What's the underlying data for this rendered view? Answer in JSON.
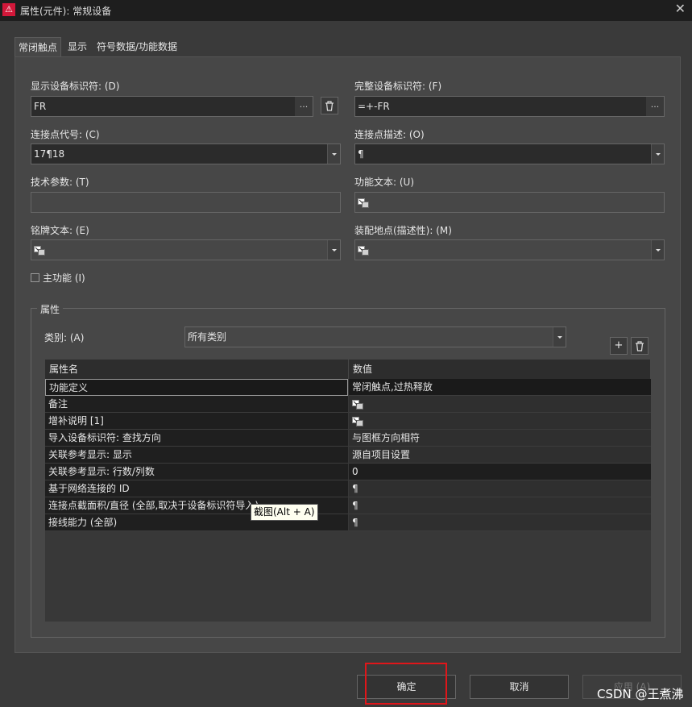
{
  "window": {
    "title": "属性(元件): 常规设备",
    "close": "✕"
  },
  "tabs": [
    "常闭触点",
    "显示",
    "符号数据/功能数据"
  ],
  "fields": {
    "display_dt_label": "显示设备标识符: (D)",
    "display_dt_value": "FR",
    "full_dt_label": "完整设备标识符: (F)",
    "full_dt_value": "=+-FR",
    "conn_code_label": "连接点代号: (C)",
    "conn_code_value": "17¶18",
    "conn_desc_label": "连接点描述: (O)",
    "conn_desc_value": "¶",
    "tech_param_label": "技术参数: (T)",
    "tech_param_value": "",
    "func_text_label": "功能文本: (U)",
    "nameplate_label": "铭牌文本: (E)",
    "mount_loc_label": "装配地点(描述性): (M)",
    "main_function_label": "主功能 (I)",
    "dots": "..."
  },
  "properties": {
    "group_title": "属性",
    "category_label": "类别: (A)",
    "category_value": "所有类别",
    "col_name": "属性名",
    "col_value": "数值",
    "rows": [
      {
        "name": "功能定义",
        "value": "常闭触点,过热释放"
      },
      {
        "name": "备注",
        "value": "",
        "icon": "multilang-text-icon"
      },
      {
        "name": "增补说明 [1]",
        "value": "",
        "icon": "multilang-text-icon"
      },
      {
        "name": "导入设备标识符: 查找方向",
        "value": "与图框方向相符"
      },
      {
        "name": "关联参考显示: 显示",
        "value": "源自项目设置"
      },
      {
        "name": "关联参考显示: 行数/列数",
        "value": "0"
      },
      {
        "name": "基于网络连接的 ID",
        "value": "¶"
      },
      {
        "name": "连接点截面积/直径 (全部,取决于设备标识符导入)",
        "value": "¶"
      },
      {
        "name": "接线能力 (全部)",
        "value": "¶"
      }
    ],
    "tooltip": "截图(Alt + A)"
  },
  "buttons": {
    "ok": "确定",
    "cancel": "取消",
    "apply": "应用 (A)"
  },
  "watermark": "CSDN @王煮沸",
  "colors": {
    "accent_red": "#e0161a",
    "app_icon": "#d2183a"
  }
}
